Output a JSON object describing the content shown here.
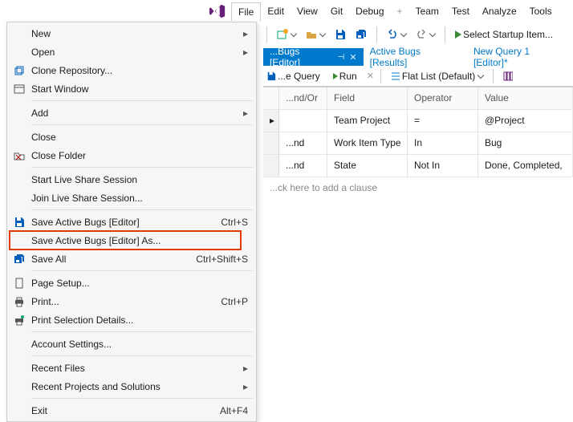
{
  "menubar": {
    "items": [
      "File",
      "Edit",
      "View",
      "Git",
      "Debug",
      "Team",
      "Test",
      "Analyze",
      "Tools"
    ],
    "active_index": 0
  },
  "toolbar": {
    "startup_label": "Select Startup Item..."
  },
  "file_menu": {
    "items": [
      {
        "label": "New",
        "icon": "",
        "shortcut": "",
        "submenu": true
      },
      {
        "label": "Open",
        "icon": "",
        "shortcut": "",
        "submenu": true
      },
      {
        "label": "Clone Repository...",
        "icon": "clone",
        "shortcut": ""
      },
      {
        "label": "Start Window",
        "icon": "window",
        "shortcut": ""
      },
      {
        "sep": true
      },
      {
        "label": "Add",
        "icon": "",
        "shortcut": "",
        "submenu": true
      },
      {
        "sep": true
      },
      {
        "label": "Close",
        "icon": "",
        "shortcut": ""
      },
      {
        "label": "Close Folder",
        "icon": "closefolder",
        "shortcut": ""
      },
      {
        "sep": true
      },
      {
        "label": "Start Live Share Session",
        "icon": "",
        "shortcut": ""
      },
      {
        "label": "Join Live Share Session...",
        "icon": "",
        "shortcut": ""
      },
      {
        "sep": true
      },
      {
        "label": "Save Active Bugs [Editor]",
        "icon": "save",
        "shortcut": "Ctrl+S"
      },
      {
        "label": "Save Active Bugs [Editor] As...",
        "icon": "",
        "shortcut": "",
        "highlight": true
      },
      {
        "label": "Save All",
        "icon": "saveall",
        "shortcut": "Ctrl+Shift+S"
      },
      {
        "sep": true
      },
      {
        "label": "Page Setup...",
        "icon": "page",
        "shortcut": ""
      },
      {
        "label": "Print...",
        "icon": "print",
        "shortcut": "Ctrl+P"
      },
      {
        "label": "Print Selection Details...",
        "icon": "printsel",
        "shortcut": ""
      },
      {
        "sep": true
      },
      {
        "label": "Account Settings...",
        "icon": "",
        "shortcut": ""
      },
      {
        "sep": true
      },
      {
        "label": "Recent Files",
        "icon": "",
        "shortcut": "",
        "submenu": true
      },
      {
        "label": "Recent Projects and Solutions",
        "icon": "",
        "shortcut": "",
        "submenu": true
      },
      {
        "sep": true
      },
      {
        "label": "Exit",
        "icon": "",
        "shortcut": "Alt+F4"
      }
    ]
  },
  "tabs": [
    {
      "label": "...Bugs [Editor]",
      "active": true,
      "pinned": true,
      "closeable": true
    },
    {
      "label": "Active Bugs [Results]",
      "active": false
    },
    {
      "label": "New Query 1 [Editor]*",
      "active": false
    }
  ],
  "query_toolbar": {
    "save_query_label": "...e Query",
    "run_label": "Run",
    "flatlist_label": "Flat List (Default)"
  },
  "grid": {
    "headers": [
      "...nd/Or",
      "Field",
      "Operator",
      "Value"
    ],
    "rows": [
      {
        "andor": "",
        "field": "Team Project",
        "op": "=",
        "value": "@Project"
      },
      {
        "andor": "...nd",
        "field": "Work Item Type",
        "op": "In",
        "value": "Bug"
      },
      {
        "andor": "...nd",
        "field": "State",
        "op": "Not In",
        "value": "Done, Completed,"
      }
    ],
    "hint": "...ck here to add a clause"
  }
}
